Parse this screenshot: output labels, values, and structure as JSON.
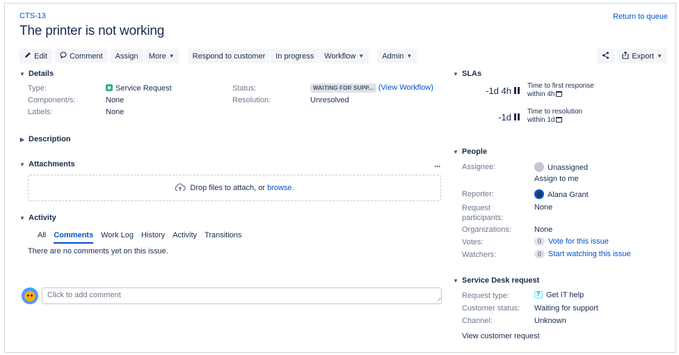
{
  "issue": {
    "key": "CTS-13",
    "title": "The printer is not working",
    "return_link": "Return to queue"
  },
  "toolbar": {
    "edit": "Edit",
    "comment": "Comment",
    "assign": "Assign",
    "more": "More",
    "respond": "Respond to customer",
    "in_progress": "In progress",
    "workflow": "Workflow",
    "admin": "Admin",
    "export": "Export"
  },
  "details": {
    "header": "Details",
    "type_label": "Type:",
    "type_value": "Service Request",
    "components_label": "Component/s:",
    "components_value": "None",
    "labels_label": "Labels:",
    "labels_value": "None",
    "status_label": "Status:",
    "status_value": "WAITING FOR SUPP...",
    "view_workflow": "(View Workflow)",
    "resolution_label": "Resolution:",
    "resolution_value": "Unresolved"
  },
  "description": {
    "header": "Description"
  },
  "attachments": {
    "header": "Attachments",
    "drop_text": "Drop files to attach, or",
    "browse": "browse."
  },
  "activity": {
    "header": "Activity",
    "tabs": [
      "All",
      "Comments",
      "Work Log",
      "History",
      "Activity",
      "Transitions"
    ],
    "active_tab": "Comments",
    "empty_text": "There are no comments yet on this issue.",
    "comment_placeholder": "Click to add comment"
  },
  "slas": {
    "header": "SLAs",
    "items": [
      {
        "time": "-1d 4h",
        "name": "Time to first response",
        "goal": "within 4h"
      },
      {
        "time": "-1d",
        "name": "Time to resolution",
        "goal": "within 1d"
      }
    ]
  },
  "people": {
    "header": "People",
    "assignee_label": "Assignee:",
    "assignee_value": "Unassigned",
    "assign_to_me": "Assign to me",
    "reporter_label": "Reporter:",
    "reporter_value": "Alana Grant",
    "participants_label_1": "Request",
    "participants_label_2": "participants:",
    "participants_value": "None",
    "organizations_label": "Organizations:",
    "organizations_value": "None",
    "votes_label": "Votes:",
    "votes_count": "0",
    "votes_link": "Vote for this issue",
    "watchers_label": "Watchers:",
    "watchers_count": "0",
    "watchers_link": "Start watching this issue"
  },
  "service_desk": {
    "header": "Service Desk request",
    "request_type_label": "Request type:",
    "request_type_value": "Get IT help",
    "customer_status_label": "Customer status:",
    "customer_status_value": "Waiting for support",
    "channel_label": "Channel:",
    "channel_value": "Unknown",
    "view_request": "View customer request"
  },
  "colors": {
    "link": "#0052cc",
    "text": "#172b4d",
    "muted": "#6b778c",
    "button_bg": "#f4f5f7",
    "service_request_green": "#36b37e"
  }
}
